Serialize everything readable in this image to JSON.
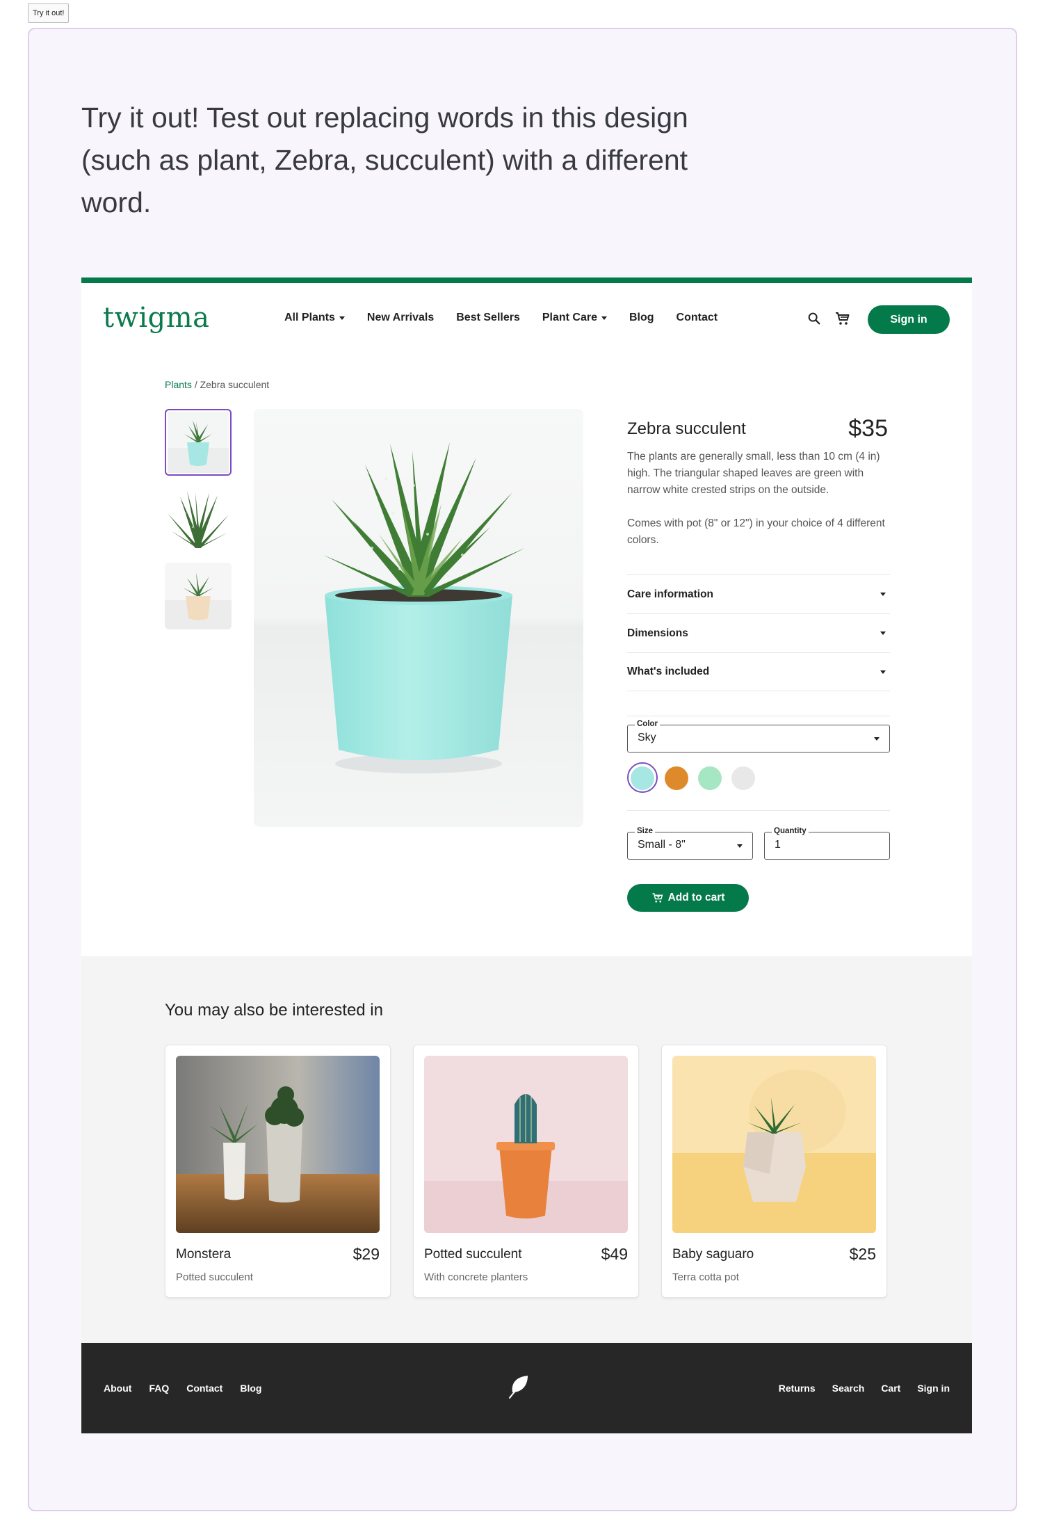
{
  "tryit_tag": "Try it out!",
  "headline": "Try it out! Test out replacing words in this design (such as plant, Zebra, succulent) with a different word.",
  "brand": {
    "name": "twigma",
    "accent": "#047a4a"
  },
  "nav": {
    "items": [
      {
        "label": "All Plants",
        "dropdown": true
      },
      {
        "label": "New Arrivals",
        "dropdown": false
      },
      {
        "label": "Best Sellers",
        "dropdown": false
      },
      {
        "label": "Plant Care",
        "dropdown": true
      },
      {
        "label": "Blog",
        "dropdown": false
      },
      {
        "label": "Contact",
        "dropdown": false
      }
    ],
    "search_icon": "search-icon",
    "cart_icon": "cart-icon",
    "signin_label": "Sign in"
  },
  "breadcrumb": {
    "root": "Plants",
    "separator": "/",
    "current": "Zebra succulent"
  },
  "product": {
    "title": "Zebra succulent",
    "price": "$35",
    "description": "The plants are generally small, less than 10 cm (4 in) high. The triangular shaped leaves are green with narrow white crested strips on the outside.",
    "description2": "Comes with pot (8\" or 12\") in your choice of 4 different colors.",
    "accordion": [
      "Care information",
      "Dimensions",
      "What's included"
    ],
    "color_label": "Color",
    "color_value": "Sky",
    "swatches": [
      "#a6e7e4",
      "#df8a2a",
      "#a6e6c2",
      "#e8e8e8"
    ],
    "size_label": "Size",
    "size_value": "Small - 8\"",
    "quantity_label": "Quantity",
    "quantity_value": "1",
    "add_to_cart": "Add to cart"
  },
  "related": {
    "title": "You may also be interested in",
    "cards": [
      {
        "name": "Monstera",
        "price": "$29",
        "subtitle": "Potted succulent"
      },
      {
        "name": "Potted succulent",
        "price": "$49",
        "subtitle": "With concrete planters"
      },
      {
        "name": "Baby saguaro",
        "price": "$25",
        "subtitle": "Terra cotta pot"
      }
    ]
  },
  "footer": {
    "left_links": [
      "About",
      "FAQ",
      "Contact",
      "Blog"
    ],
    "right_links": [
      "Returns",
      "Search",
      "Cart",
      "Sign in"
    ],
    "logo_icon": "leaf-icon"
  }
}
